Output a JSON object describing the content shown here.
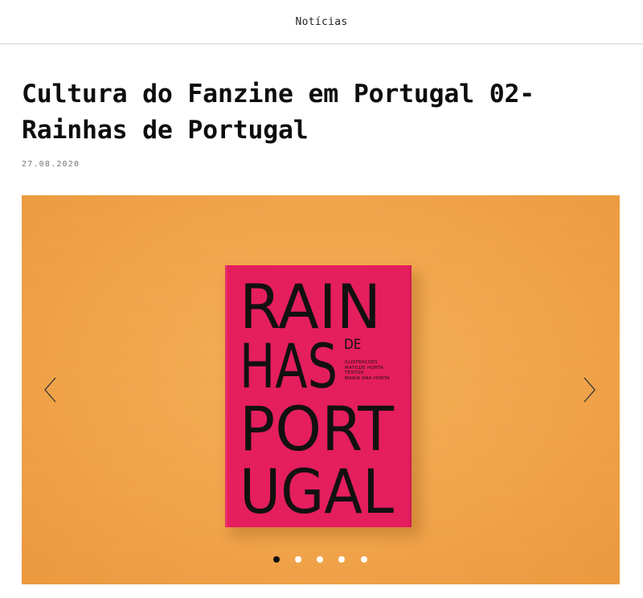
{
  "nav": {
    "label": "Notícias"
  },
  "article": {
    "title": "Cultura do Fanzine em Portugal 02- Rainhas de Portugal",
    "date": "27.08.2020"
  },
  "slider": {
    "cover_title_lines": [
      "RAIN",
      "HAS",
      "PORT",
      "UGAL"
    ],
    "cover_de": "DE",
    "cover_credits": [
      "ILUSTRAÇÕES",
      "MATILDE HORTA",
      "TEXTOS",
      "MARIA ANA HORTA"
    ],
    "slide_count": 5,
    "active_slide": 1,
    "prev_icon": "chevron-left-icon",
    "next_icon": "chevron-right-icon"
  },
  "colors": {
    "background": "#f2a44a",
    "book": "#e51e5e",
    "dot_active": "#111111",
    "dot_inactive": "#ffffff"
  }
}
